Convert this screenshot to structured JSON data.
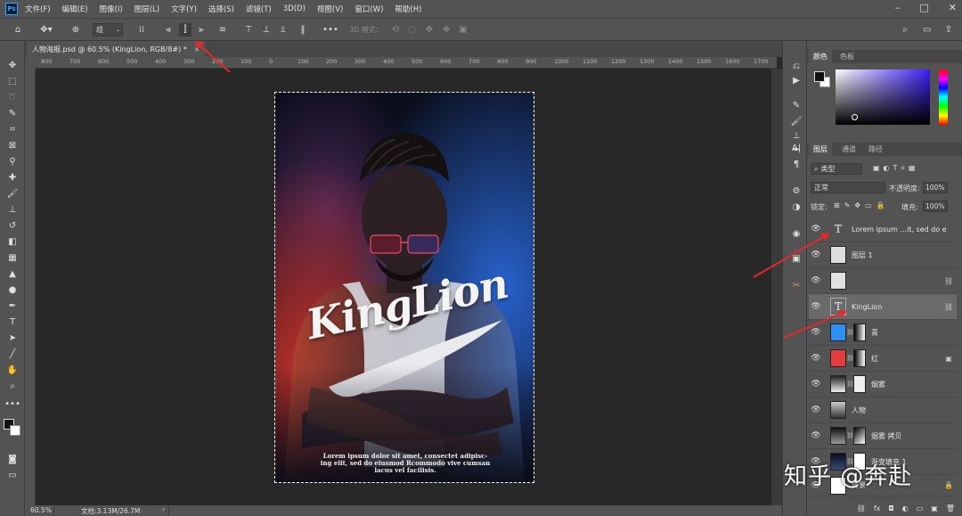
{
  "menu": {
    "logo": "Ps",
    "items": [
      "文件(F)",
      "编辑(E)",
      "图像(I)",
      "图层(L)",
      "文字(Y)",
      "选择(S)",
      "滤镜(T)",
      "3D(D)",
      "视图(V)",
      "窗口(W)",
      "帮助(H)"
    ],
    "window_controls": [
      "–",
      "□",
      "✕"
    ]
  },
  "options": {
    "auto_select_value": "组",
    "three_d_mode_label": "3D 模式："
  },
  "document": {
    "tab_title": "人物海报.psd @ 60.5% (KingLion, RGB/8#) *",
    "tab_close": "×",
    "zoom": "60.5%",
    "doc_size": "文档:3.13M/26.7M"
  },
  "ruler": {
    "h_ticks": [
      "800",
      "700",
      "600",
      "500",
      "400",
      "300",
      "200",
      "100",
      "0",
      "100",
      "200",
      "300",
      "400",
      "500",
      "600",
      "700",
      "800",
      "900",
      "1000",
      "1100",
      "1200",
      "1300",
      "1400",
      "1500",
      "1600",
      "1700"
    ]
  },
  "poster": {
    "logo_text": "KingLion",
    "body_text": "Lorem ipsum dolor sit amet, consectet adipisc- ing elit, sed do eiusmod Rcommodo vive cumsan lacus vel facilisis."
  },
  "color_panel": {
    "tabs": [
      "颜色",
      "色板"
    ]
  },
  "layers_panel": {
    "tabs": [
      "图层",
      "通道",
      "路径"
    ],
    "filter_label": "类型",
    "blend_mode": "正常",
    "opacity_label": "不透明度:",
    "opacity_value": "100%",
    "lock_label": "锁定:",
    "fill_label": "填充:",
    "fill_value": "100%",
    "layers": [
      {
        "name": "Lorem ipsum ...it, sed do e",
        "thumb": "T"
      },
      {
        "name": "图层 1",
        "thumb": ""
      },
      {
        "name": "",
        "thumb": ""
      },
      {
        "name": "KingLion",
        "thumb": "T"
      },
      {
        "name": "青",
        "thumb": ""
      },
      {
        "name": "红",
        "thumb": ""
      },
      {
        "name": "烟雾",
        "thumb": ""
      },
      {
        "name": "人物",
        "thumb": ""
      },
      {
        "name": "烟雾 拷贝",
        "thumb": ""
      },
      {
        "name": "渐变填充 1",
        "thumb": ""
      },
      {
        "name": "背景",
        "thumb": ""
      }
    ],
    "footer_icons": [
      "⛓",
      "fx",
      "◘",
      "◐",
      "▭",
      "▣",
      "🗑"
    ]
  },
  "watermark": "知乎 @奔赴",
  "colors": {
    "cyan_fill": "#2f8ff0",
    "red_fill": "#e53c3c",
    "annotation_arrow": "#e32b2b"
  }
}
